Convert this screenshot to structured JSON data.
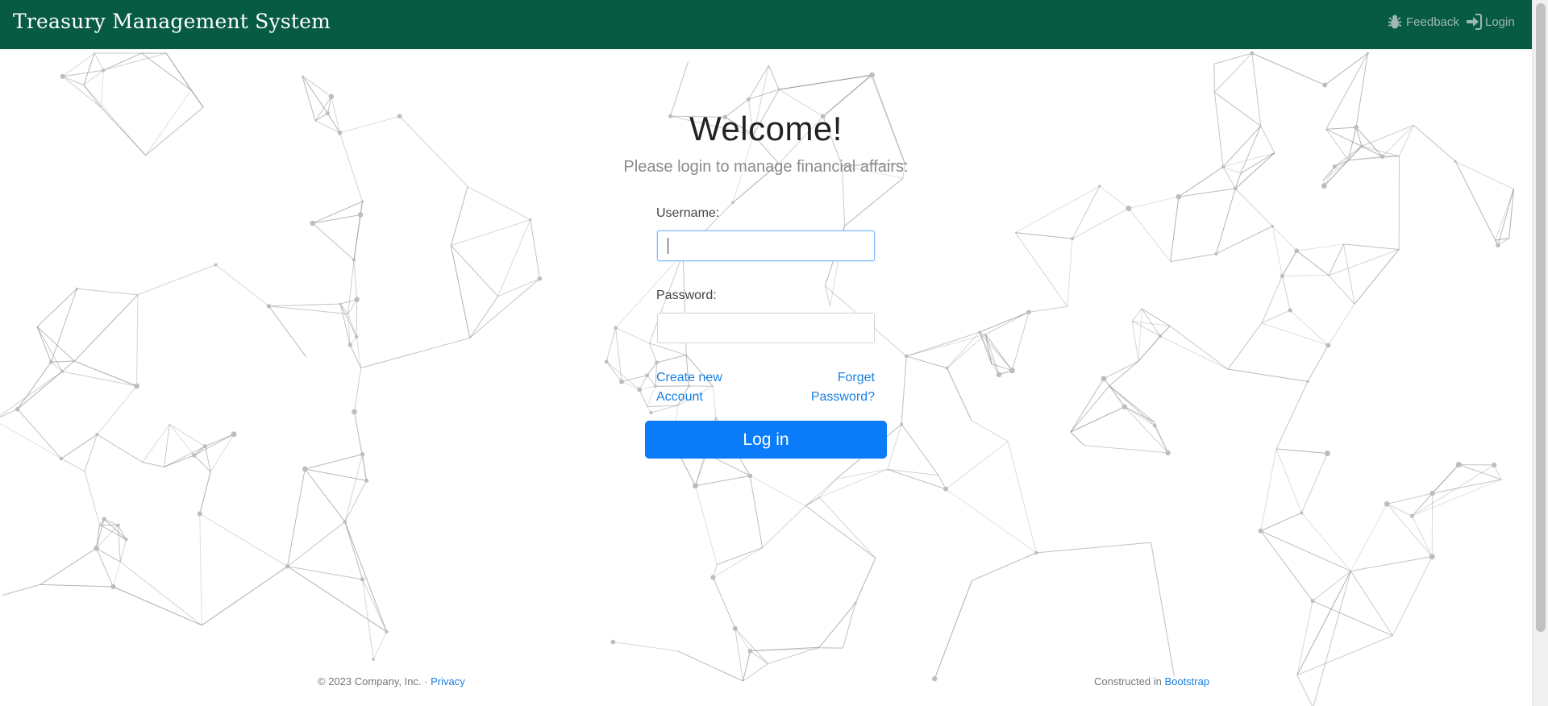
{
  "navbar": {
    "brand": "Treasury Management System",
    "feedback": {
      "label": "Feedback",
      "icon": "bug-icon"
    },
    "login": {
      "label": "Login",
      "icon": "sign-in-icon"
    },
    "bg_color": "#075b43"
  },
  "main": {
    "title": "Welcome!",
    "subtitle": "Please login to manage financial affairs:",
    "username_label": "Username:",
    "username_value": "",
    "password_label": "Password:",
    "password_value": "",
    "create_account": "Create new Account",
    "forget_password": "Forget Password?",
    "login_button": "Log in",
    "button_color": "#0a7bf9",
    "link_color": "#1a7fe0"
  },
  "footer": {
    "copyright": "© 2023 Company, Inc. · ",
    "privacy": "Privacy",
    "constructed": "Constructed in ",
    "bootstrap": "Bootstrap"
  }
}
